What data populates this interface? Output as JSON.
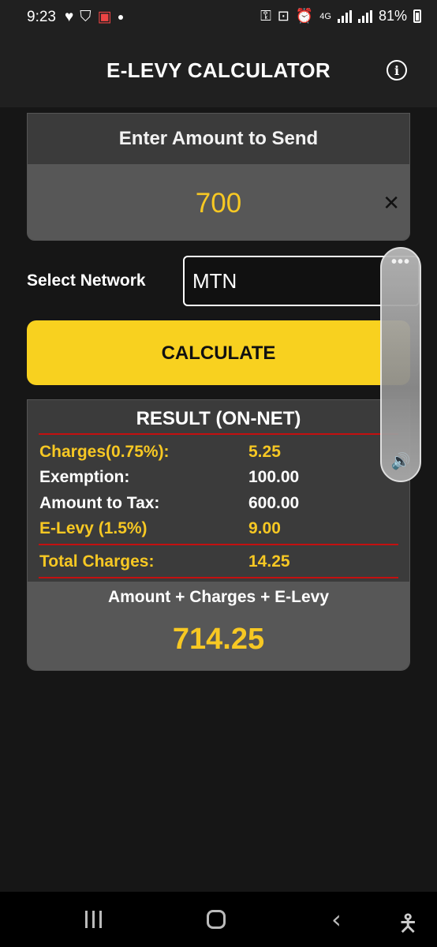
{
  "status_bar": {
    "time": "9:23",
    "battery": "81%",
    "network_type": "4G"
  },
  "app": {
    "title": "E-LEVY CALCULATOR"
  },
  "amount": {
    "label": "Enter Amount to Send",
    "value": "700",
    "clear_symbol": "✕"
  },
  "network": {
    "label": "Select Network",
    "selected": "MTN"
  },
  "calculate": {
    "label": "CALCULATE"
  },
  "result": {
    "title": "RESULT (ON-NET)",
    "rows": [
      {
        "label": "Charges(0.75%):",
        "value": "5.25",
        "color": "#f7c823"
      },
      {
        "label": "Exemption:",
        "value": "100.00",
        "color": "#ffffff"
      },
      {
        "label": "Amount to Tax:",
        "value": "600.00",
        "color": "#ffffff"
      },
      {
        "label": "E-Levy (1.5%)",
        "value": "9.00",
        "color": "#f7c823"
      }
    ],
    "total": {
      "label": "Total Charges:",
      "value": "14.25"
    },
    "grand_caption": "Amount + Charges + E-Levy",
    "grand_value": "714.25"
  },
  "colors": {
    "accent_yellow": "#f8d11f",
    "divider_red": "#c41010",
    "background": "#161616"
  }
}
